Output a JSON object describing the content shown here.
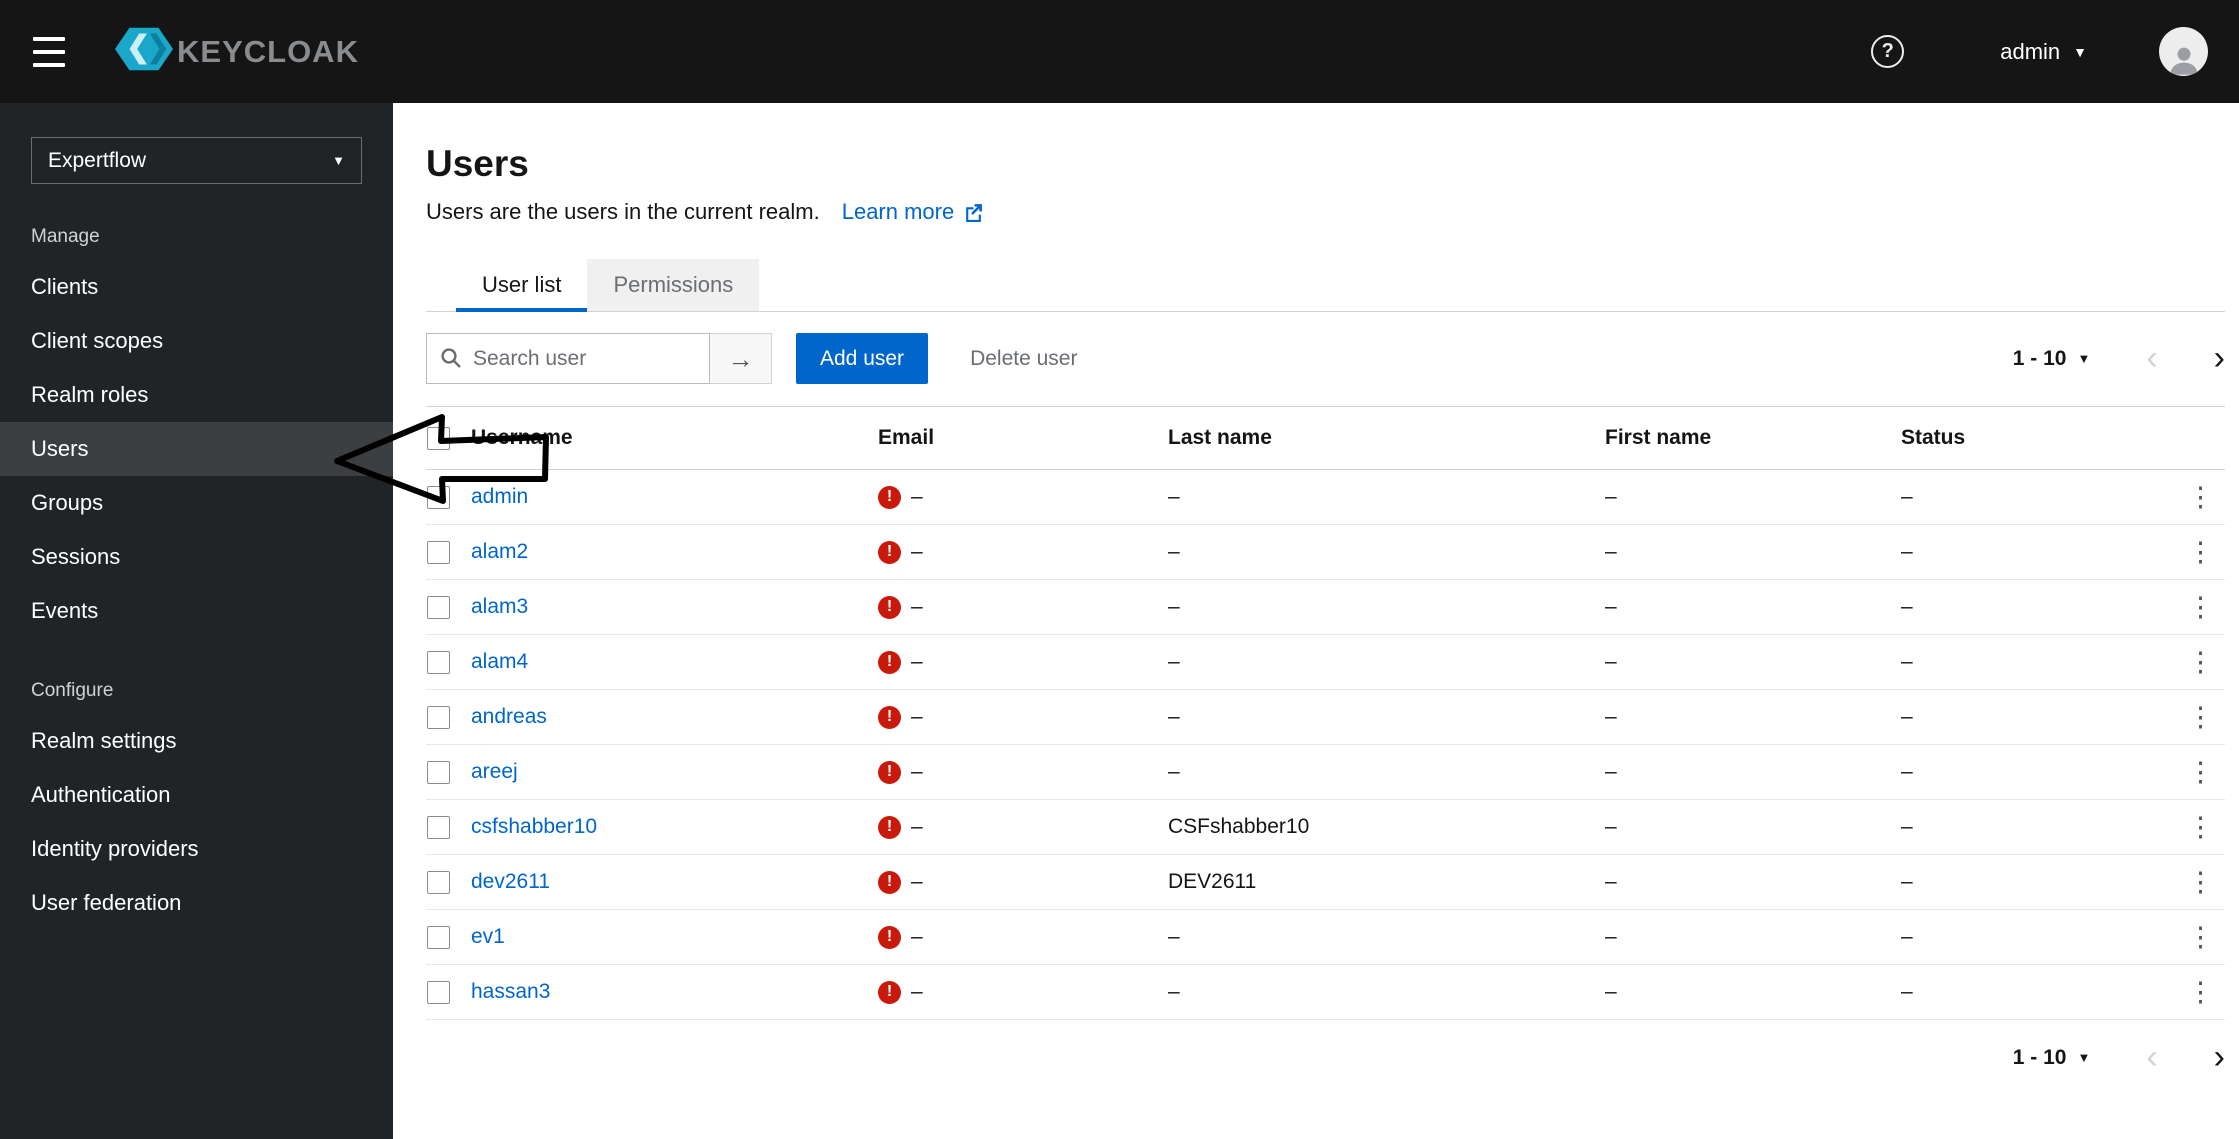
{
  "colors": {
    "accent": "#0066cc",
    "warning": "#c9190b",
    "masthead": "#151515",
    "sidebar": "#212427"
  },
  "header": {
    "brand": "KEYCLOAK",
    "user_menu": {
      "username": "admin"
    }
  },
  "sidebar": {
    "realm_selector": "Expertflow",
    "selected_item": "Users",
    "sections": [
      {
        "label": "Manage",
        "items": [
          "Clients",
          "Client scopes",
          "Realm roles",
          "Users",
          "Groups",
          "Sessions",
          "Events"
        ]
      },
      {
        "label": "Configure",
        "items": [
          "Realm settings",
          "Authentication",
          "Identity providers",
          "User federation"
        ]
      }
    ]
  },
  "main": {
    "title": "Users",
    "subtitle": "Users are the users in the current realm.",
    "learn_more_label": "Learn more",
    "tabs": [
      {
        "label": "User list",
        "active": true
      },
      {
        "label": "Permissions",
        "active": false
      }
    ],
    "toolbar": {
      "search_placeholder": "Search user",
      "add_user_label": "Add user",
      "delete_user_label": "Delete user"
    },
    "pagination": {
      "range": "1 - 10"
    },
    "table": {
      "columns": [
        "Username",
        "Email",
        "Last name",
        "First name",
        "Status"
      ],
      "empty_value": "–",
      "rows": [
        {
          "username": "admin",
          "email": "–",
          "email_warning": true,
          "last_name": "–",
          "first_name": "–",
          "status": "–"
        },
        {
          "username": "alam2",
          "email": "–",
          "email_warning": true,
          "last_name": "–",
          "first_name": "–",
          "status": "–"
        },
        {
          "username": "alam3",
          "email": "–",
          "email_warning": true,
          "last_name": "–",
          "first_name": "–",
          "status": "–"
        },
        {
          "username": "alam4",
          "email": "–",
          "email_warning": true,
          "last_name": "–",
          "first_name": "–",
          "status": "–"
        },
        {
          "username": "andreas",
          "email": "–",
          "email_warning": true,
          "last_name": "–",
          "first_name": "–",
          "status": "–"
        },
        {
          "username": "areej",
          "email": "–",
          "email_warning": true,
          "last_name": "–",
          "first_name": "–",
          "status": "–"
        },
        {
          "username": "csfshabber10",
          "email": "–",
          "email_warning": true,
          "last_name": "CSFshabber10",
          "first_name": "–",
          "status": "–"
        },
        {
          "username": "dev2611",
          "email": "–",
          "email_warning": true,
          "last_name": "DEV2611",
          "first_name": "–",
          "status": "–"
        },
        {
          "username": "ev1",
          "email": "–",
          "email_warning": true,
          "last_name": "–",
          "first_name": "–",
          "status": "–"
        },
        {
          "username": "hassan3",
          "email": "–",
          "email_warning": true,
          "last_name": "–",
          "first_name": "–",
          "status": "–"
        }
      ]
    }
  }
}
